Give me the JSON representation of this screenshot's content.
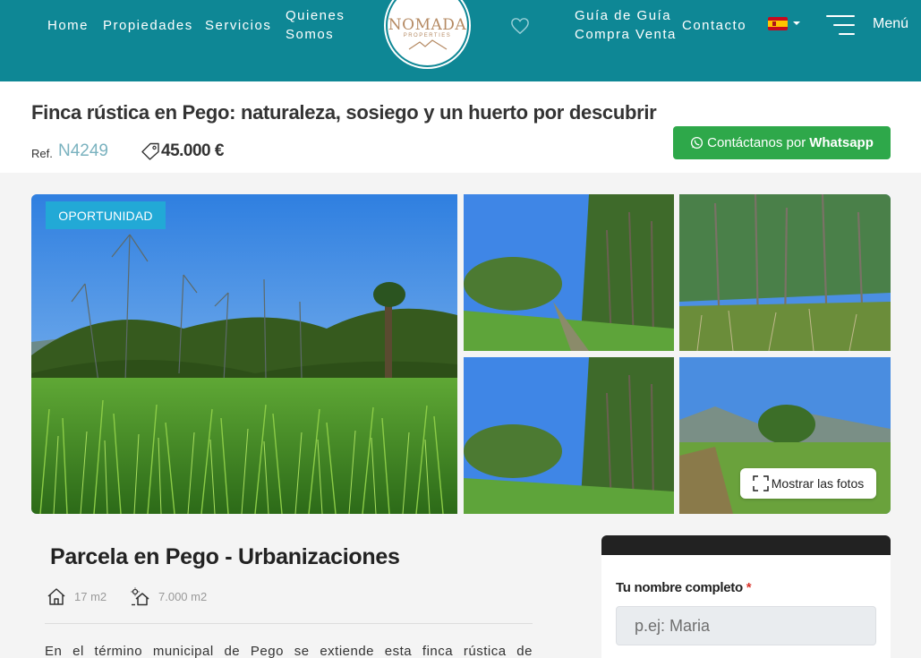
{
  "header": {
    "nav": {
      "home": "Home",
      "propiedades": "Propiedades",
      "servicios": "Servicios",
      "quienes_1": "Quienes",
      "quienes_2": "Somos",
      "guia_1": "Guía de Guía",
      "guia_2": "Compra Venta",
      "contacto": "Contacto"
    },
    "logo": {
      "name": "NOMADA",
      "tagline": "PROPERTIES"
    },
    "menu_label": "Menú",
    "icons": {
      "favorites": "heart-icon",
      "language": "spain-flag-icon",
      "menu": "hamburger-icon"
    }
  },
  "listing": {
    "title": "Finca rústica en Pego: naturaleza, sosiego y un huerto por descubrir",
    "ref_label": "Ref.",
    "ref_value": "N4249",
    "price": "45.000 €",
    "whatsapp_text": "Contáctanos por ",
    "whatsapp_bold": "Whatsapp"
  },
  "gallery": {
    "badge": "OPORTUNIDAD",
    "show_photos": "Mostrar las fotos",
    "photo_count": 5
  },
  "details": {
    "section_title": "Parcela en Pego  -  Urbanizaciones",
    "built_area": "17 m2",
    "plot_area": "7.000 m2",
    "description_start": "En el término municipal de Pego se extiende esta finca rústica de"
  },
  "form": {
    "name_label": "Tu nombre completo",
    "required_mark": "*",
    "name_placeholder": "p.ej: Maria"
  },
  "colors": {
    "header_bg": "#0e8795",
    "whatsapp": "#2ea84a",
    "badge": "#22a9d6",
    "ref": "#7ab2bf",
    "logo_gold": "#b58a63"
  }
}
